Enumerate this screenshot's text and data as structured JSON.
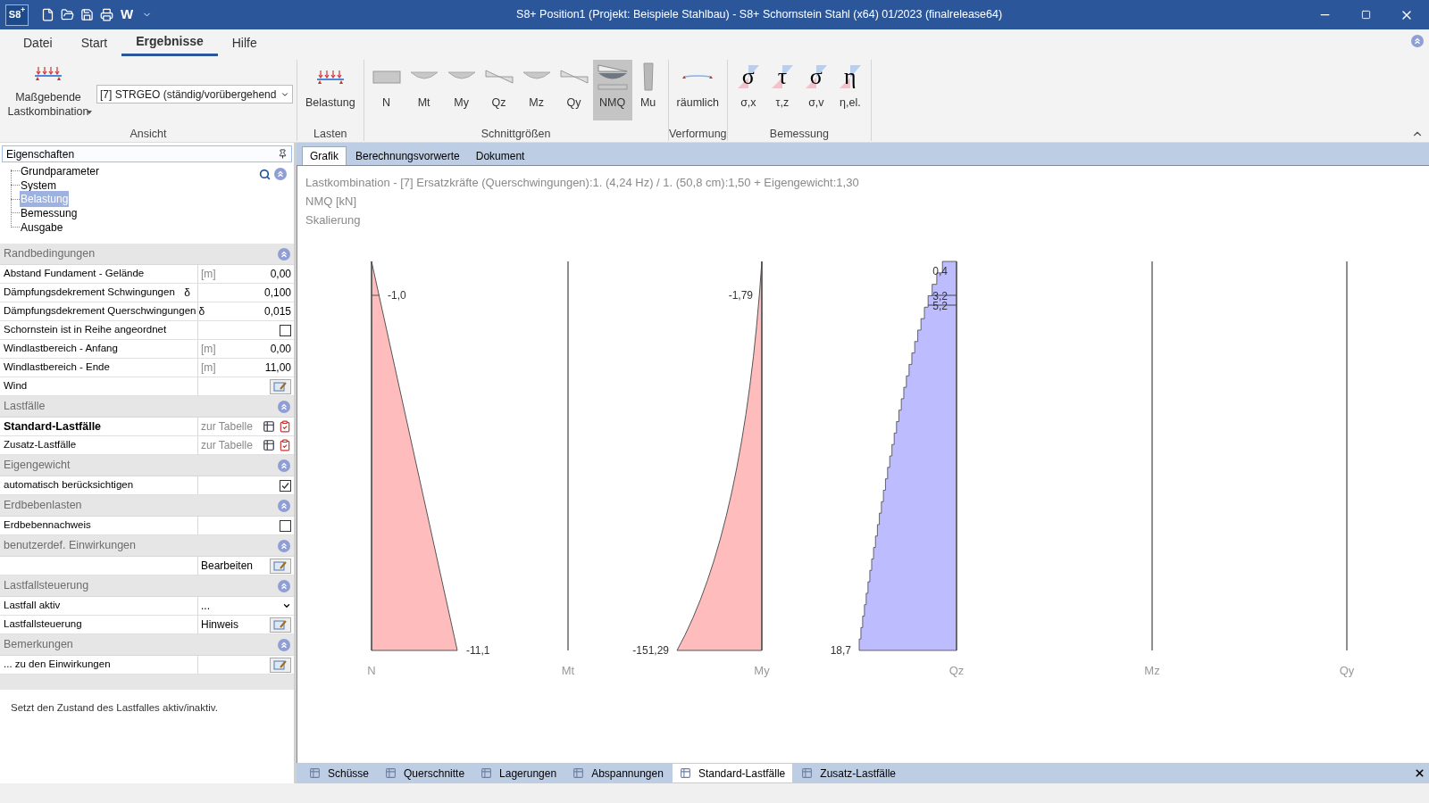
{
  "window": {
    "logo": "S8$^{+}$",
    "quick_text": "W",
    "title": "S8+ Position1 (Projekt: Beispiele Stahlbau) - S8+ Schornstein Stahl (x64) 01/2023 (finalrelease64)"
  },
  "menu_tabs": [
    {
      "label": "Datei",
      "selected": false
    },
    {
      "label": "Start",
      "selected": false
    },
    {
      "label": "Ergebnisse",
      "selected": true
    },
    {
      "label": "Hilfe",
      "selected": false
    }
  ],
  "ribbon": {
    "combo_button": {
      "label": "Maßgebende Lastkombination"
    },
    "combo_value": "[7] STRGEO (ständig/vorübergehend",
    "groups": [
      {
        "label": "Ansicht"
      },
      {
        "label": "Lasten",
        "buttons": [
          {
            "label": "Belastung",
            "kind": "loads",
            "selected": false
          }
        ]
      },
      {
        "label": "Schnittgrößen",
        "buttons": [
          {
            "label": "N",
            "kind": "rect",
            "selected": false
          },
          {
            "label": "Mt",
            "kind": "arc",
            "selected": false
          },
          {
            "label": "My",
            "kind": "arc",
            "selected": false
          },
          {
            "label": "Qz",
            "kind": "zigzag",
            "selected": false
          },
          {
            "label": "Mz",
            "kind": "arc",
            "selected": false
          },
          {
            "label": "Qy",
            "kind": "zigzag",
            "selected": false
          },
          {
            "label": "NMQ",
            "kind": "nmq",
            "selected": true
          },
          {
            "label": "Mu",
            "kind": "bar",
            "selected": false
          }
        ]
      },
      {
        "label": "Verformung",
        "buttons": [
          {
            "label": "räumlich",
            "kind": "deform",
            "selected": false
          }
        ]
      },
      {
        "label": "Bemessung",
        "buttons": [
          {
            "label": "σ,x",
            "kind": "greek",
            "glyph": "σ",
            "selected": false
          },
          {
            "label": "τ,z",
            "kind": "greek",
            "glyph": "τ",
            "selected": false
          },
          {
            "label": "σ,v",
            "kind": "greek",
            "glyph": "σ",
            "selected": false
          },
          {
            "label": "η,el.",
            "kind": "greek",
            "glyph": "η",
            "selected": false
          }
        ]
      }
    ]
  },
  "properties": {
    "title": "Eigenschaften",
    "tree": [
      {
        "label": "Grundparameter",
        "selected": false
      },
      {
        "label": "System",
        "selected": false
      },
      {
        "label": "Belastung",
        "selected": true
      },
      {
        "label": "Bemessung",
        "selected": false
      },
      {
        "label": "Ausgabe",
        "selected": false
      }
    ],
    "sections": [
      {
        "title": "Randbedingungen",
        "rows": [
          {
            "kind": "value",
            "label": "Abstand Fundament - Gelände",
            "unit": "[m]",
            "value": "0,00"
          },
          {
            "kind": "value",
            "label": "Dämpfungsdekrement Schwingungen",
            "symbol": "δ",
            "value": "0,100"
          },
          {
            "kind": "value",
            "label": "Dämpfungsdekrement Querschwingungen",
            "symbol": "δ",
            "value": "0,015"
          },
          {
            "kind": "checkbox",
            "label": "Schornstein ist in Reihe angeordnet",
            "checked": false
          },
          {
            "kind": "value",
            "label": "Windlastbereich - Anfang",
            "unit": "[m]",
            "value": "0,00"
          },
          {
            "kind": "value",
            "label": "Windlastbereich - Ende",
            "unit": "[m]",
            "value": "11,00"
          },
          {
            "kind": "edit",
            "label": "Wind"
          }
        ]
      },
      {
        "title": "Lastfälle",
        "rows": [
          {
            "kind": "table",
            "label": "Standard-Lastfälle",
            "bold": true,
            "value": "zur Tabelle"
          },
          {
            "kind": "table",
            "label": "Zusatz-Lastfälle",
            "bold": false,
            "value": "zur Tabelle"
          }
        ]
      },
      {
        "title": "Eigengewicht",
        "rows": [
          {
            "kind": "checkbox",
            "label": "automatisch berücksichtigen",
            "checked": true
          }
        ]
      },
      {
        "title": "Erdbebenlasten",
        "rows": [
          {
            "kind": "checkbox",
            "label": "Erdbebennachweis",
            "checked": false
          }
        ]
      },
      {
        "title": "benutzerdef. Einwirkungen",
        "rows": [
          {
            "kind": "edit",
            "value": "Bearbeiten"
          }
        ]
      },
      {
        "title": "Lastfallsteuerung",
        "rows": [
          {
            "kind": "dropdown",
            "label": "Lastfall aktiv",
            "value": "..."
          },
          {
            "kind": "edit",
            "label": "Lastfallsteuerung",
            "value": "Hinweis"
          }
        ]
      },
      {
        "title": "Bemerkungen",
        "rows": [
          {
            "kind": "edit",
            "label": "... zu den Einwirkungen"
          }
        ]
      }
    ],
    "description": "Setzt den Zustand des Lastfalles aktiv/inaktiv."
  },
  "doc_tabs": [
    {
      "label": "Grafik",
      "selected": true
    },
    {
      "label": "Berechnungsvorwerte",
      "selected": false
    },
    {
      "label": "Dokument",
      "selected": false
    }
  ],
  "graphic": {
    "lines": [
      "Lastkombination - [7] Ersatzkräfte (Querschwingungen):1. (4,24 Hz) / 1. (50,8 cm):1,50 + Eigengewicht:1,30",
      "NMQ [kN]",
      "Skalierung"
    ],
    "diagrams": [
      {
        "axis": "N",
        "kind": "triangle",
        "top_labels": [
          "-1,0"
        ],
        "bottom_label": "-11,1"
      },
      {
        "axis": "Mt",
        "kind": "none"
      },
      {
        "axis": "My",
        "kind": "curve",
        "top_labels": [
          "-1,79"
        ],
        "bottom_label": "-151,29"
      },
      {
        "axis": "Qz",
        "kind": "steps",
        "top_labels": [
          "0,4",
          "3,2",
          "5,2"
        ],
        "bottom_label": "18,7"
      },
      {
        "axis": "Mz",
        "kind": "none"
      },
      {
        "axis": "Qy",
        "kind": "none"
      }
    ]
  },
  "bottom_tabs": [
    {
      "label": "Schüsse",
      "selected": false
    },
    {
      "label": "Querschnitte",
      "selected": false
    },
    {
      "label": "Lagerungen",
      "selected": false
    },
    {
      "label": "Abspannungen",
      "selected": false
    },
    {
      "label": "Standard-Lastfälle",
      "selected": true
    },
    {
      "label": "Zusatz-Lastfälle",
      "selected": false
    }
  ]
}
